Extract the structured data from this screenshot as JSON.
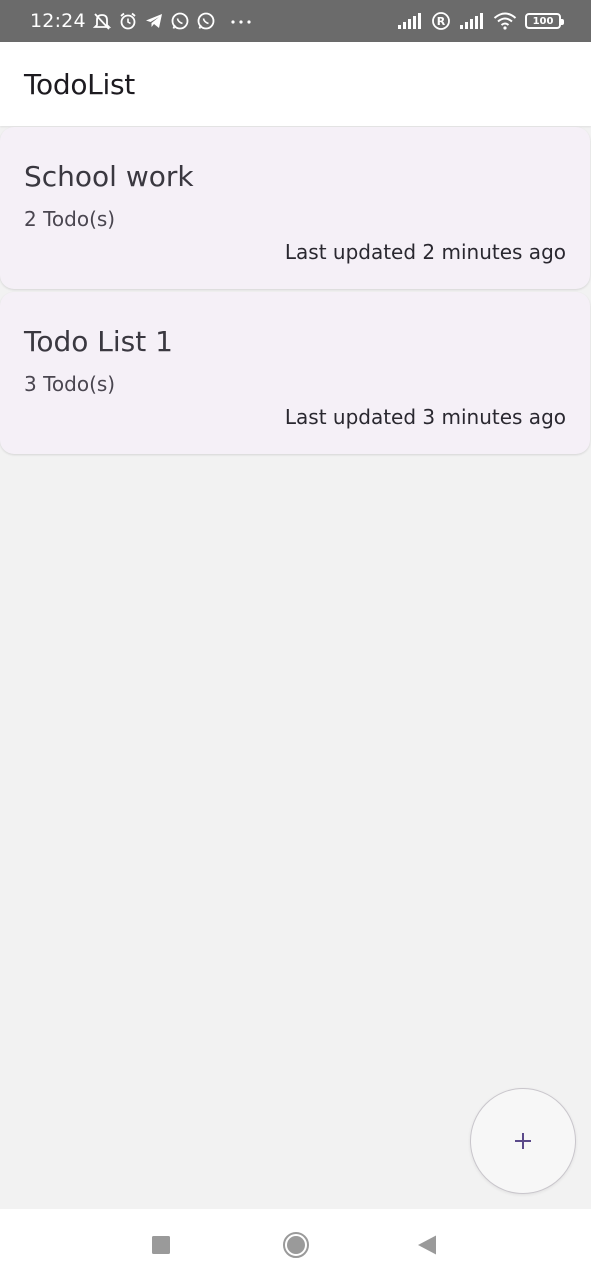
{
  "status_bar": {
    "time": "12:24",
    "left_icons": [
      "notifications-off-icon",
      "alarm-icon",
      "telegram-icon",
      "whatsapp-icon",
      "whatsapp-icon",
      "more-dots-icon"
    ],
    "right_icons": [
      "signal-icon",
      "roaming-r-icon",
      "signal-icon",
      "wifi-icon"
    ],
    "battery": "100"
  },
  "app_bar": {
    "title": "TodoList"
  },
  "lists": [
    {
      "title": "School work",
      "count": "2 Todo(s)",
      "updated": "Last updated 2 minutes ago"
    },
    {
      "title": "Todo List 1",
      "count": "3 Todo(s)",
      "updated": "Last updated 3 minutes ago"
    }
  ],
  "fab": {
    "icon": "add-icon",
    "color": "#5b4a8a"
  },
  "nav_bar": {
    "buttons": [
      "recents-square-icon",
      "home-circle-icon",
      "back-triangle-icon"
    ]
  },
  "colors": {
    "background": "#f2f2f2",
    "card": "#f5f0f7",
    "status_bar": "#6b6b6b"
  }
}
